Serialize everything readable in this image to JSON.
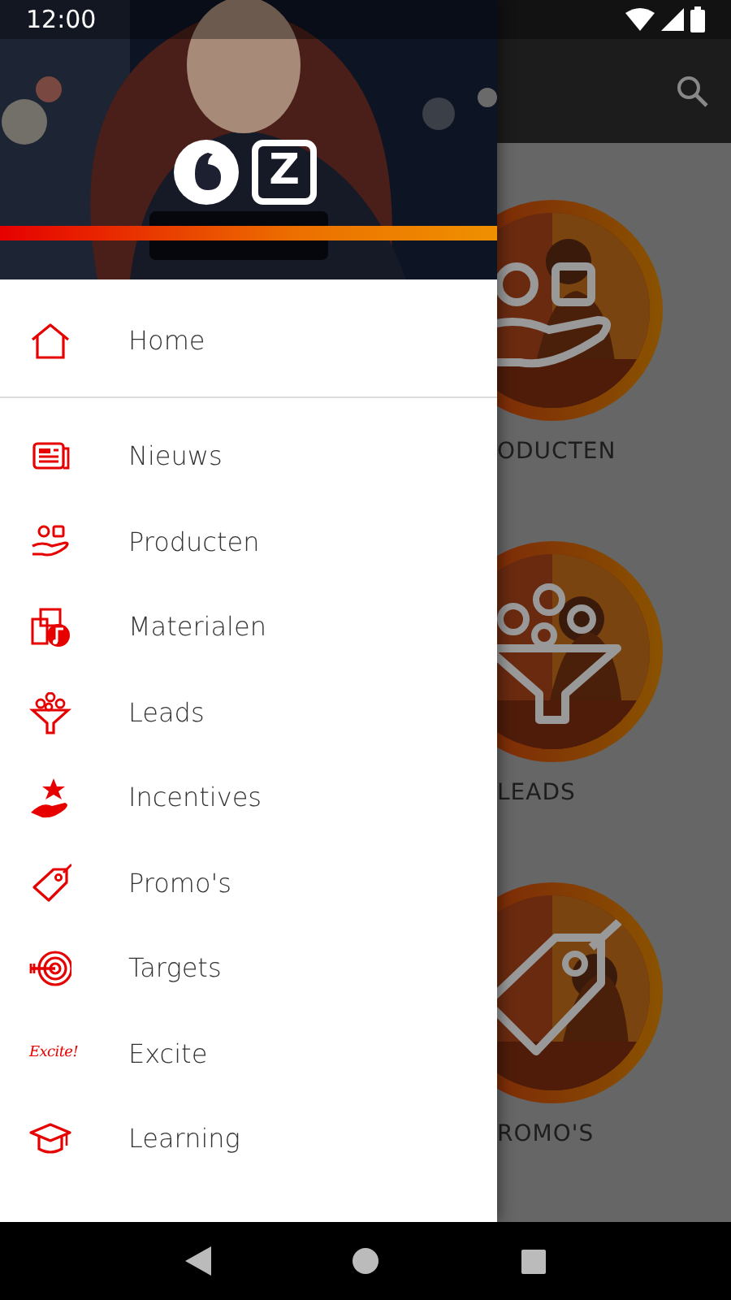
{
  "status_bar": {
    "time": "12:00"
  },
  "drawer": {
    "header": {
      "kind": "picture",
      "logo_letter": "Z"
    },
    "home": {
      "label": "Home"
    },
    "items": [
      {
        "label": "Nieuws"
      },
      {
        "label": "Producten"
      },
      {
        "label": "Materialen"
      },
      {
        "label": "Leads"
      },
      {
        "label": "Incentives"
      },
      {
        "label": "Promo's"
      },
      {
        "label": "Targets"
      },
      {
        "label": "Excite",
        "logo_text": "Excite!"
      },
      {
        "label": "Learning"
      }
    ]
  },
  "tiles": [
    {
      "label": "ODUCTEN"
    },
    {
      "label": "LEADS"
    },
    {
      "label": "ROMO'S"
    }
  ]
}
